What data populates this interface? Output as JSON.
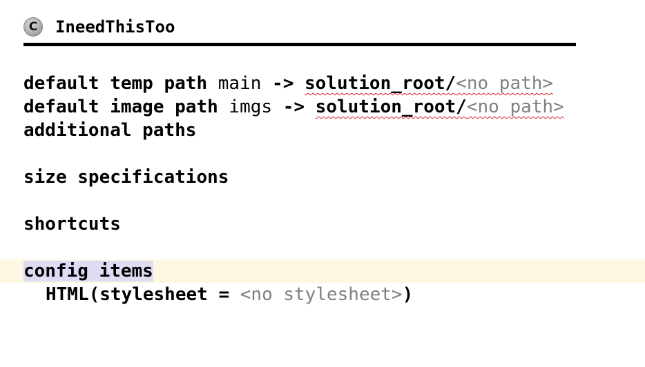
{
  "header": {
    "icon_letter": "C",
    "concept_name": "IneedThisToo"
  },
  "lines": {
    "temp_path": {
      "label": "default temp path",
      "name": "main",
      "arrow": "->",
      "root": "solution_root/",
      "placeholder": "<no path>"
    },
    "image_path": {
      "label": "default image path",
      "name": "imgs",
      "arrow": "->",
      "root": "solution_root/",
      "placeholder": "<no path>"
    },
    "additional_paths": "additional paths",
    "size_specifications": "size specifications",
    "shortcuts": "shortcuts",
    "config_items": "config items",
    "html_item": {
      "prefix": "HTML(stylesheet = ",
      "placeholder": "<no stylesheet>",
      "suffix": ")"
    }
  },
  "colors": {
    "highlight_row": "#fdf8e3",
    "selection": "#dedbf3",
    "error_underline": "#e02020",
    "placeholder_text": "#808080"
  }
}
